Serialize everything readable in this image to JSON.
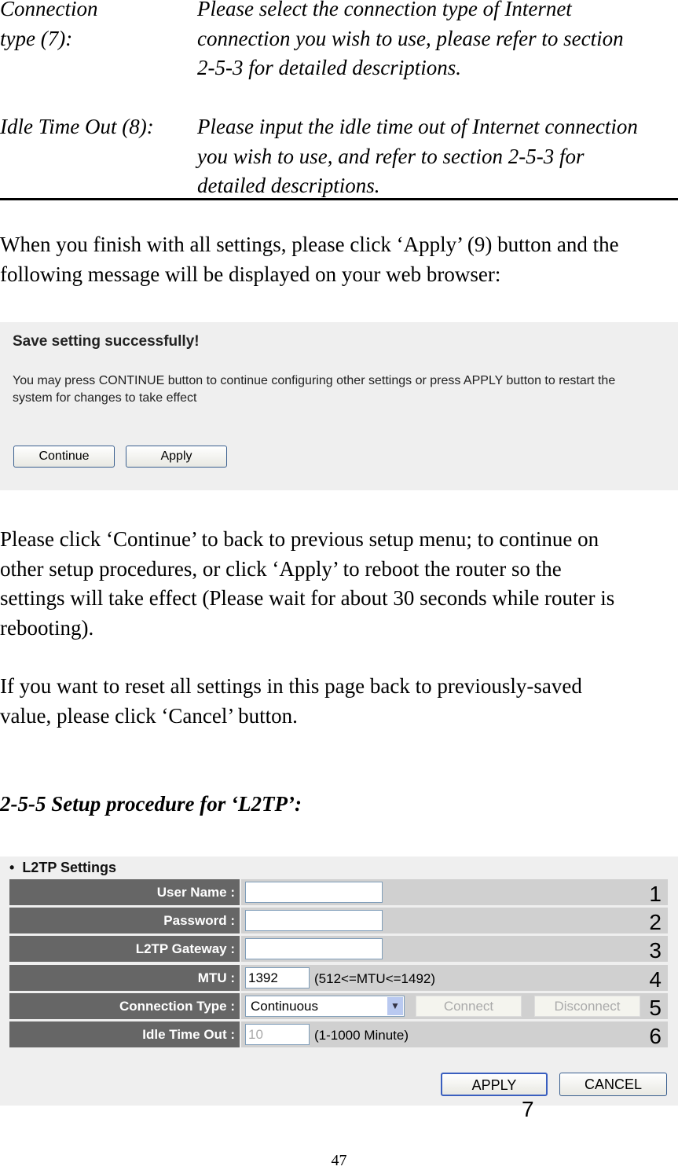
{
  "definitions": [
    {
      "term_lines": [
        "Connection",
        "type (7):"
      ],
      "desc_lines": [
        "Please select the connection type of Internet",
        "connection you wish to use, please refer to section",
        "2-5-3 for detailed descriptions."
      ]
    },
    {
      "term_lines": [
        "Idle Time Out (8):"
      ],
      "desc_lines": [
        "Please input the idle time out of Internet connection",
        "you wish to use, and refer to section 2-5-3 for",
        "detailed descriptions."
      ]
    }
  ],
  "para1": [
    "When you finish with all settings, please click ‘Apply’ (9) button and the",
    "following message will be displayed on your web browser:"
  ],
  "save_dialog": {
    "title": "Save setting successfully!",
    "message_lines": [
      "You may press CONTINUE button to continue configuring other settings or press APPLY button to restart the",
      "system for changes to take effect"
    ],
    "continue_label": "Continue",
    "apply_label": "Apply"
  },
  "para2": [
    "Please click ‘Continue’ to back to previous setup menu; to continue on",
    "other setup procedures, or click ‘Apply’ to reboot the router so the",
    "settings will take effect (Please wait for about 30 seconds while router is",
    "rebooting)."
  ],
  "para3": [
    "If you want to reset all settings in this page back to previously-saved",
    "value, please click ‘Cancel’ button."
  ],
  "heading": "2-5-5 Setup procedure for ‘L2TP’:",
  "l2tp": {
    "title": "L2TP Settings",
    "rows": [
      {
        "label": "User Name :",
        "value": "",
        "marker": "1"
      },
      {
        "label": "Password :",
        "value": "",
        "marker": "2"
      },
      {
        "label": "L2TP Gateway :",
        "value": "",
        "marker": "3"
      },
      {
        "label": "MTU :",
        "value": "1392",
        "hint": "(512<=MTU<=1492)",
        "marker": "4"
      },
      {
        "label": "Connection Type :",
        "value": "Continuous",
        "connect_label": "Connect",
        "disconnect_label": "Disconnect",
        "marker": "5"
      },
      {
        "label": "Idle Time Out :",
        "value": "10",
        "hint": "(1-1000 Minute)",
        "marker": "6"
      }
    ],
    "apply_label": "APPLY",
    "cancel_label": "CANCEL",
    "buttons_marker": "7"
  },
  "page_number": "47"
}
